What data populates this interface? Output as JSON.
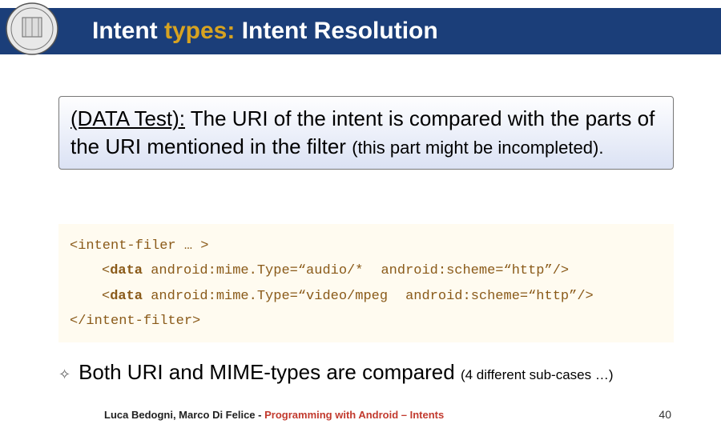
{
  "header": {
    "title_prefix": "Intent ",
    "title_accent": "types:",
    "title_suffix": " Intent Resolution"
  },
  "box": {
    "label": "(DATA Test):",
    "main_text": " The URI of the intent is compared with the parts of the URI mentioned in the filter ",
    "tail_text": "(this part might be incompleted)."
  },
  "code": {
    "open_tag_name": "intent-filer",
    "open_tag_rest": " … >",
    "data_line1_tag": "data",
    "data_line1_attrs1": " android:mime.Type=“audio/*",
    "data_line1_attrs2": "android:scheme=“http”/>",
    "data_line2_tag": "data",
    "data_line2_attrs1": " android:mime.Type=“video/mpeg",
    "data_line2_attrs2": "android:scheme=“http”/>",
    "close_tag": "</intent-filter>"
  },
  "bullet": {
    "main": "Both URI and MIME-types are compared ",
    "tail": "(4 different sub-cases …)"
  },
  "footer": {
    "authors": "Luca Bedogni, Marco Di Felice",
    "dash": " - ",
    "topic": "Programming with Android – Intents",
    "page": "40"
  }
}
